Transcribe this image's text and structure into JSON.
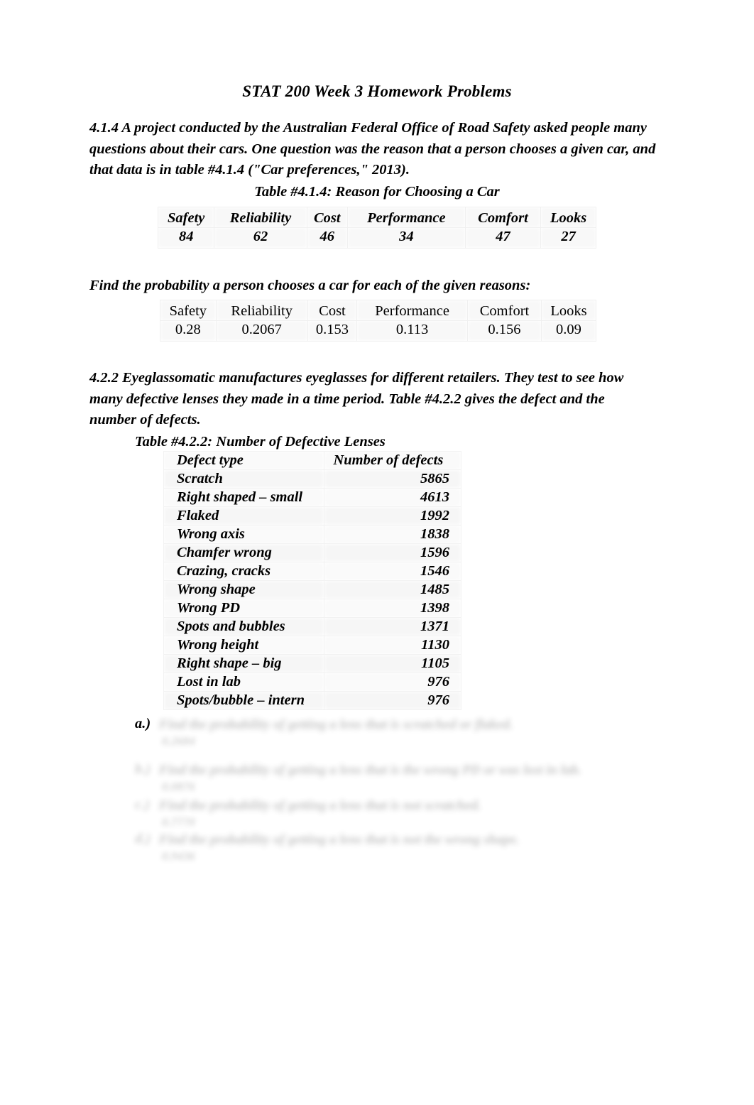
{
  "document": {
    "title": "STAT 200 Week 3 Homework Problems"
  },
  "problem_414": {
    "text": "4.1.4 A project conducted by the Australian Federal Office of Road Safety asked people many questions about their cars.  One question was the reason that a person chooses a given car, and that data is in table #4.1.4 (\"Car preferences,\" 2013).",
    "table_caption": "Table #4.1.4: Reason for Choosing a Car",
    "table": {
      "headers": [
        "Safety",
        "Reliability",
        "Cost",
        "Performance",
        "Comfort",
        "Looks"
      ],
      "counts": [
        "84",
        "62",
        "46",
        "34",
        "47",
        "27"
      ]
    },
    "prompt": "Find the probability a person chooses a car for each of the given reasons:",
    "probability_table": {
      "headers": [
        "Safety",
        "Reliability",
        "Cost",
        "Performance",
        "Comfort",
        "Looks"
      ],
      "values": [
        "0.28",
        "0.2067",
        "0.153",
        "0.113",
        "0.156",
        "0.09"
      ]
    }
  },
  "problem_422": {
    "text": "4.2.2 Eyeglassomatic manufactures eyeglasses for different retailers.  They test to see how many defective lenses they made in a time period.  Table #4.2.2 gives the defect and the number of defects.",
    "table_caption": "Table #4.2.2: Number of Defective Lenses",
    "table": {
      "headers": [
        "Defect type",
        "Number of defects"
      ],
      "rows": [
        [
          "Scratch",
          "5865"
        ],
        [
          "Right shaped – small",
          "4613"
        ],
        [
          "Flaked",
          "1992"
        ],
        [
          "Wrong axis",
          "1838"
        ],
        [
          "Chamfer wrong",
          "1596"
        ],
        [
          "Crazing, cracks",
          "1546"
        ],
        [
          "Wrong shape",
          "1485"
        ],
        [
          "Wrong PD",
          "1398"
        ],
        [
          "Spots and bubbles",
          "1371"
        ],
        [
          "Wrong height",
          "1130"
        ],
        [
          "Right shape – big",
          "1105"
        ],
        [
          "Lost in lab",
          "976"
        ],
        [
          "Spots/bubble – intern",
          "976"
        ]
      ]
    },
    "questions": [
      {
        "marker": "a.)",
        "text": "Find the probability of getting a lens that is scratched or flaked.",
        "answer": "0.2684"
      },
      {
        "marker": "b.)",
        "text": "Find the probability of getting a lens that is the wrong PD or was lost in lab.",
        "answer": "0.0876"
      },
      {
        "marker": "c.)",
        "text": "Find the probability of getting a lens that is not scratched.",
        "answer": "0.7770"
      },
      {
        "marker": "d.)",
        "text": "Find the probability of getting a lens that is not the wrong shape.",
        "answer": "0.9436"
      }
    ]
  }
}
